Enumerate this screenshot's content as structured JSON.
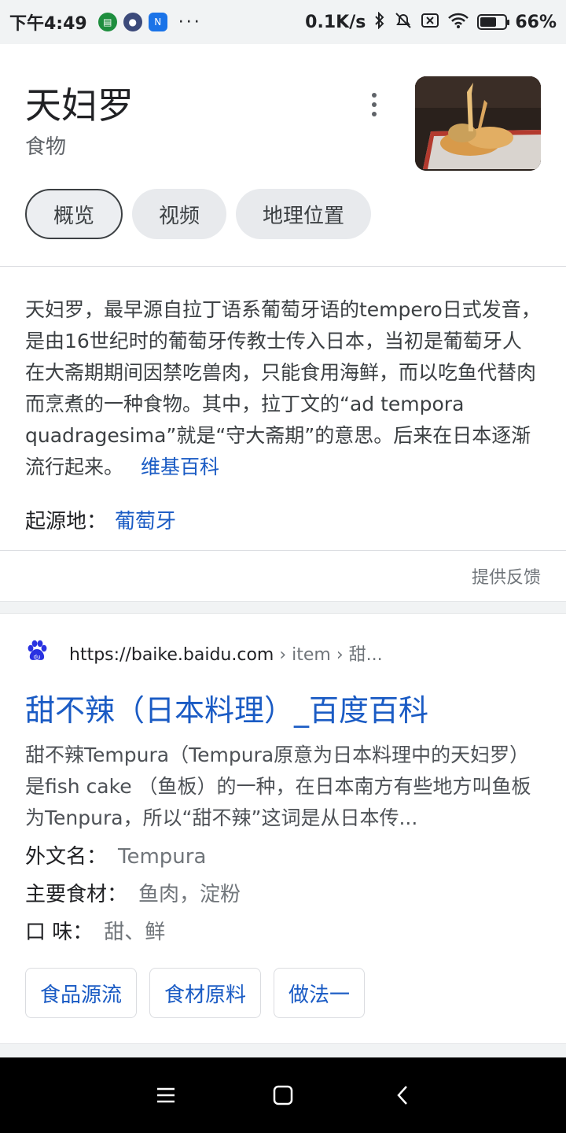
{
  "status_bar": {
    "time": "下午4:49",
    "more": "···",
    "net_speed": "0.1K/s",
    "battery_level": 0.66,
    "battery_text": "66%"
  },
  "knowledge_panel": {
    "title": "天妇罗",
    "subtitle": "食物",
    "tabs": [
      {
        "label": "概览",
        "active": true
      },
      {
        "label": "视频",
        "active": false
      },
      {
        "label": "地理位置",
        "active": false
      }
    ],
    "description": "天妇罗，最早源自拉丁语系葡萄牙语的tempero日式发音，是由16世纪时的葡萄牙传教士传入日本，当初是葡萄牙人在大斋期期间因禁吃兽肉，只能食用海鲜，而以吃鱼代替肉而烹煮的一种食物。其中，拉丁文的“ad tempora quadragesima”就是“守大斋期”的意思。后来在日本逐渐流行起来。",
    "description_source": "维基百科",
    "origin_label": "起源地：",
    "origin_value": "葡萄牙",
    "feedback": "提供反馈"
  },
  "result": {
    "url_domain": "https://baike.baidu.com",
    "url_path": " › item › 甜...",
    "title": "甜不辣（日本料理）_百度百科",
    "snippet": "甜不辣Tempura（Tempura原意为日本料理中的天妇罗）是fish cake （鱼板）的一种，在日本南方有些地方叫鱼板为Tenpura，所以“甜不辣”这词是从日本传...",
    "attributes": [
      {
        "label": "外文名：",
        "value": "Tempura"
      },
      {
        "label": "主要食材：",
        "value": "鱼肉，淀粉"
      },
      {
        "label": "口 味：",
        "value": "甜、鲜"
      }
    ],
    "buttons": [
      "食品源流",
      "食材原料",
      "做法一"
    ]
  },
  "colors": {
    "link": "#1a5bc4",
    "chip_bg": "#e8eaed",
    "baidu_blue": "#2932e1"
  }
}
